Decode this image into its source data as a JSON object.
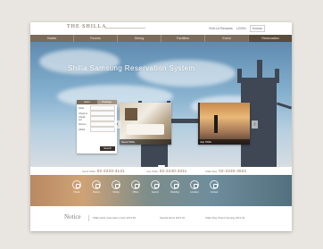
{
  "header": {
    "logo": "THE SHILLA",
    "utility_links": [
      "SHILLA Rewards",
      "LOGIN"
    ],
    "language": "Korean"
  },
  "nav": {
    "items": [
      "Hotels",
      "Rooms",
      "Dining",
      "Facilities",
      "Event",
      "Reservation"
    ],
    "active_index": 5
  },
  "hero": {
    "title": "Shilla Samsung Reservation System"
  },
  "booking": {
    "tabs": [
      "Hotel",
      "Package"
    ],
    "rows": [
      "Hotel",
      "Check-in",
      "Check-out",
      "Rooms",
      "Adults"
    ],
    "search_label": "Search"
  },
  "photos": [
    {
      "caption": "Seoul Shilla",
      "icon": "hotel-room-photo"
    },
    {
      "caption": "Jeju Shilla",
      "icon": "city-view-photo"
    }
  ],
  "phones": [
    {
      "label": "Seoul Shilla",
      "number": "02-2233-3131"
    },
    {
      "label": "Jeju Shilla",
      "number": "02-2230-3311"
    },
    {
      "label": "Shilla Stay",
      "number": "02-2230-3622"
    }
  ],
  "quick_links": [
    {
      "label": "Hotels",
      "icon": "building-icon"
    },
    {
      "label": "Rooms",
      "icon": "bed-icon"
    },
    {
      "label": "Dining",
      "icon": "dining-icon"
    },
    {
      "label": "Offers",
      "icon": "gift-icon"
    },
    {
      "label": "Events",
      "icon": "calendar-icon"
    },
    {
      "label": "Wedding",
      "icon": "ring-icon"
    },
    {
      "label": "Location",
      "icon": "map-pin-icon"
    },
    {
      "label": "Contact",
      "icon": "phone-icon"
    }
  ],
  "footer": {
    "notice_title": "Notice",
    "notices": [
      "Shilla Hotel reservation notice 2013.05",
      "Special Event 2013.04",
      "Shilla Stay Grand Opening 2013.03"
    ]
  }
}
